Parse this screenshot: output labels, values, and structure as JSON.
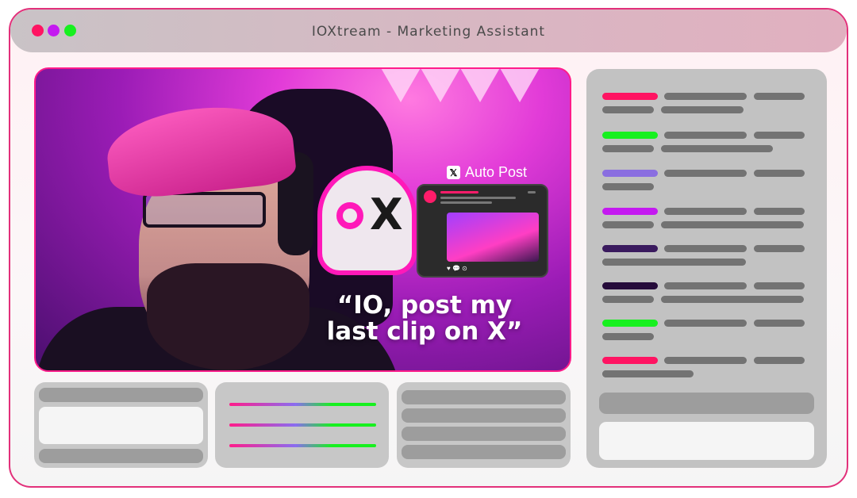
{
  "window": {
    "title": "IOXtream - Marketing Assistant",
    "controls": [
      "close",
      "minimize",
      "maximize"
    ],
    "colors": {
      "close": "#ff1462",
      "minimize": "#c419f0",
      "maximize": "#17f01f",
      "border": "#e2307a"
    }
  },
  "video": {
    "auto_post_label": "Auto Post",
    "x_logo": "𝕏",
    "mascot_letters": "X",
    "quote_line1": "“IO, post my",
    "quote_line2": "last clip on X”",
    "post_card_icons": "♥ 💬 ⊙"
  },
  "sidebar": {
    "rows": [
      {
        "accent": "#ff1462"
      },
      {
        "accent": "#17f01f"
      },
      {
        "accent": "#8a6ee0"
      },
      {
        "accent": "#c419f0"
      },
      {
        "accent": "#3a1a5e"
      },
      {
        "accent": "#250b3a"
      },
      {
        "accent": "#17f01f"
      },
      {
        "accent": "#ff1462"
      }
    ]
  }
}
